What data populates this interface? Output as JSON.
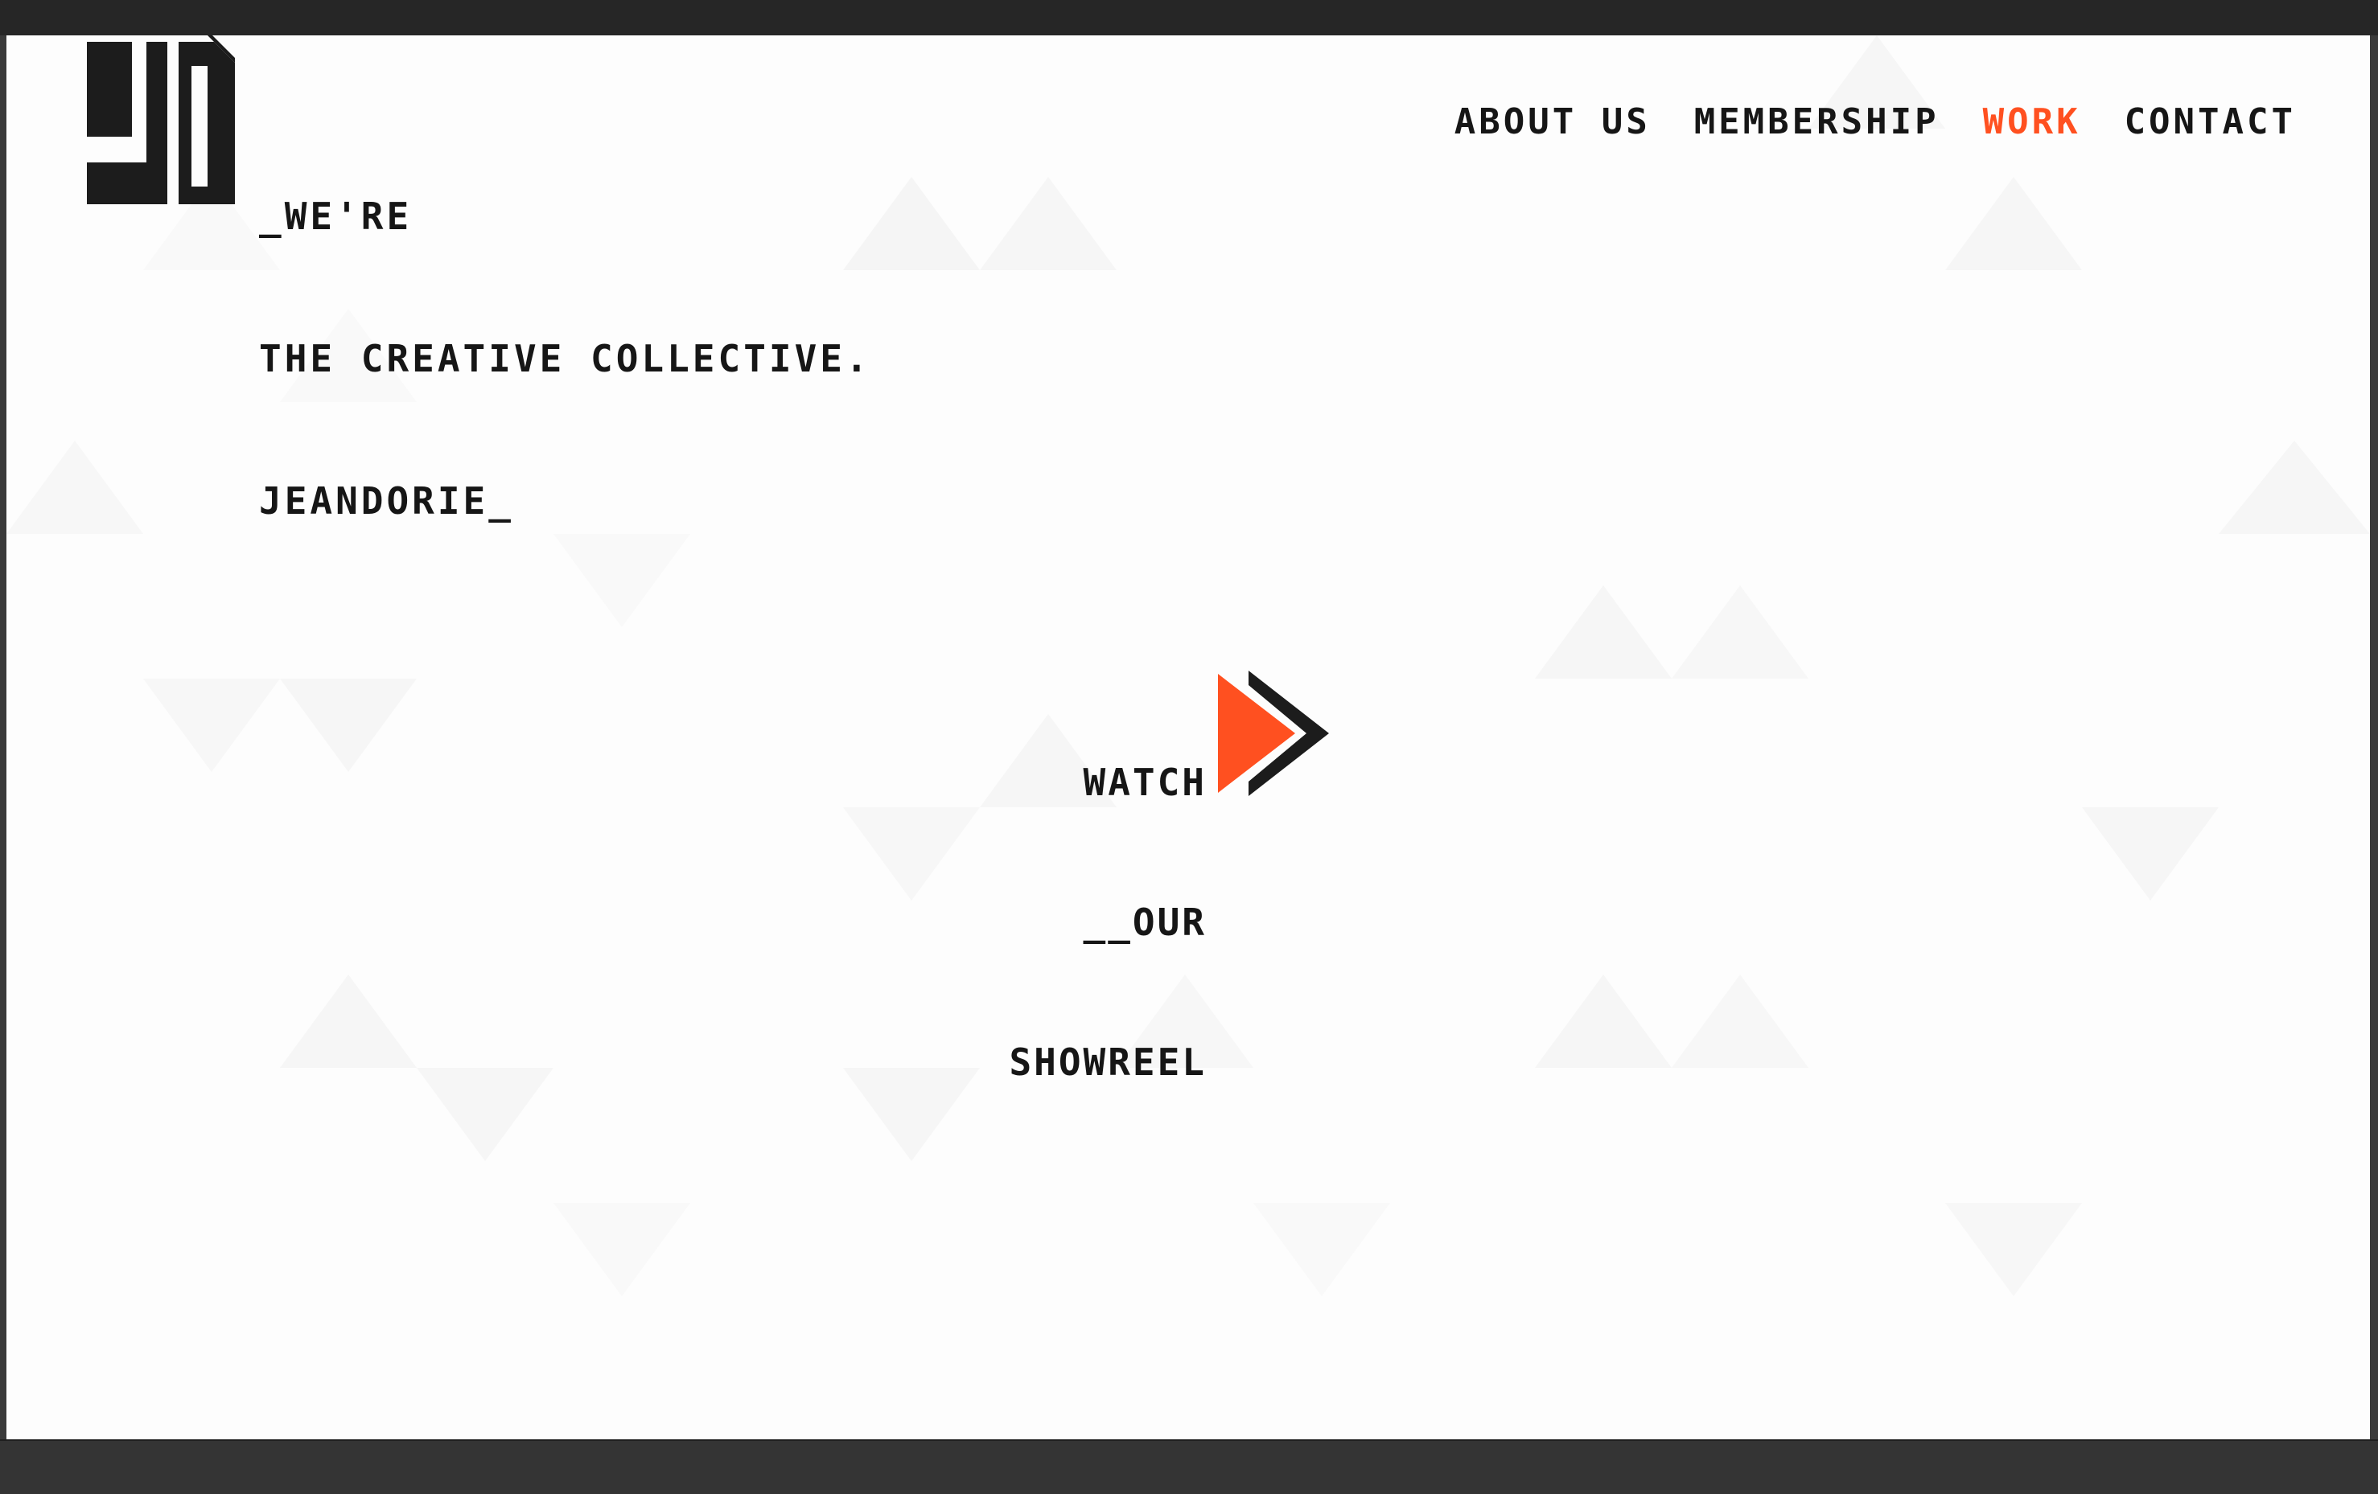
{
  "header": {
    "tagline": [
      "_WE'RE",
      "THE CREATIVE COLLECTIVE.",
      "JEANDORIE_"
    ],
    "logo_alt": "JD"
  },
  "nav": {
    "items": [
      {
        "label": "ABOUT US",
        "active": false
      },
      {
        "label": "MEMBERSHIP",
        "active": false
      },
      {
        "label": "WORK",
        "active": true
      },
      {
        "label": "CONTACT",
        "active": false
      }
    ]
  },
  "hero": {
    "showreel": [
      "WATCH",
      "__OUR",
      "SHOWREEL"
    ]
  },
  "icons": {
    "play": "play-icon",
    "logo": "jd-logo-icon"
  },
  "colors": {
    "accent": "#ff5020",
    "text": "#161616",
    "background": "#fdfdfd"
  }
}
